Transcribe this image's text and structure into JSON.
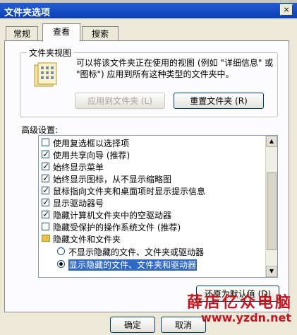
{
  "window": {
    "title": "文件夹选项",
    "close_glyph": "×"
  },
  "tabs": [
    {
      "label": "常规",
      "active": false
    },
    {
      "label": "查看",
      "active": true
    },
    {
      "label": "搜索",
      "active": false
    }
  ],
  "folder_views": {
    "title": "文件夹视图",
    "description": "可以将该文件夹正在使用的视图 (例如 \"详细信息\" 或 \"图标\") 应用到所有这种类型的文件夹中。",
    "apply_label": "应用到文件夹 (L)",
    "reset_label": "重置文件夹 (R)"
  },
  "advanced": {
    "label": "高级设置:",
    "items": [
      {
        "type": "checkbox",
        "checked": false,
        "label": "使用复选框以选择项"
      },
      {
        "type": "checkbox",
        "checked": true,
        "label": "使用共享向导 (推荐)"
      },
      {
        "type": "checkbox",
        "checked": true,
        "label": "始终显示菜单"
      },
      {
        "type": "checkbox",
        "checked": true,
        "label": "始终显示图标，从不显示缩略图"
      },
      {
        "type": "checkbox",
        "checked": true,
        "label": "鼠标指向文件夹和桌面项时显示提示信息"
      },
      {
        "type": "checkbox",
        "checked": true,
        "label": "显示驱动器号"
      },
      {
        "type": "checkbox",
        "checked": true,
        "label": "隐藏计算机文件夹中的空驱动器"
      },
      {
        "type": "checkbox",
        "checked": false,
        "label": "隐藏受保护的操作系统文件 (推荐)"
      },
      {
        "type": "folder",
        "label": "隐藏文件和文件夹"
      },
      {
        "type": "radio",
        "selected": false,
        "label": "不显示隐藏的文件、文件夹或驱动器"
      },
      {
        "type": "radio",
        "selected": true,
        "label": "显示隐藏的文件、文件夹和驱动器"
      }
    ]
  },
  "restore_defaults_label": "还原为默认值 (D)",
  "ok_label": "确定",
  "cancel_label": "取消",
  "watermark": {
    "text": "薛店亿众电脑",
    "url": "www.yzdn.net"
  }
}
